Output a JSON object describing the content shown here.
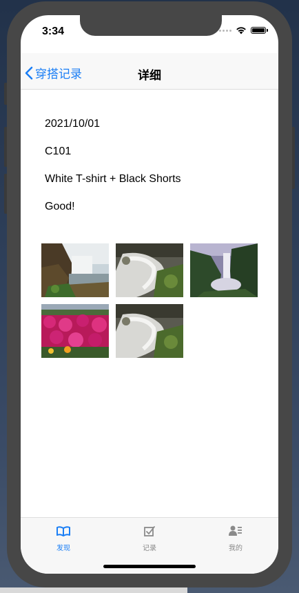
{
  "status_bar": {
    "time": "3:34"
  },
  "nav": {
    "back_label": "穿搭记录",
    "title": "详细"
  },
  "record": {
    "date": "2021/10/01",
    "code": "C101",
    "outfit": "White T-shirt + Black Shorts",
    "comment": "Good!"
  },
  "photos": [
    {
      "name": "waterfall-rocks-photo"
    },
    {
      "name": "stream-cascade-photo"
    },
    {
      "name": "misty-waterfall-photo"
    },
    {
      "name": "pink-flowers-photo"
    },
    {
      "name": "stream-cascade-photo-2"
    }
  ],
  "tabs": [
    {
      "label": "发现",
      "icon": "book-icon",
      "active": true
    },
    {
      "label": "记录",
      "icon": "checkbox-icon",
      "active": false
    },
    {
      "label": "我的",
      "icon": "profile-icon",
      "active": false
    }
  ],
  "colors": {
    "accent": "#1a7ef5",
    "inactive_tab": "#8a8a8a"
  }
}
